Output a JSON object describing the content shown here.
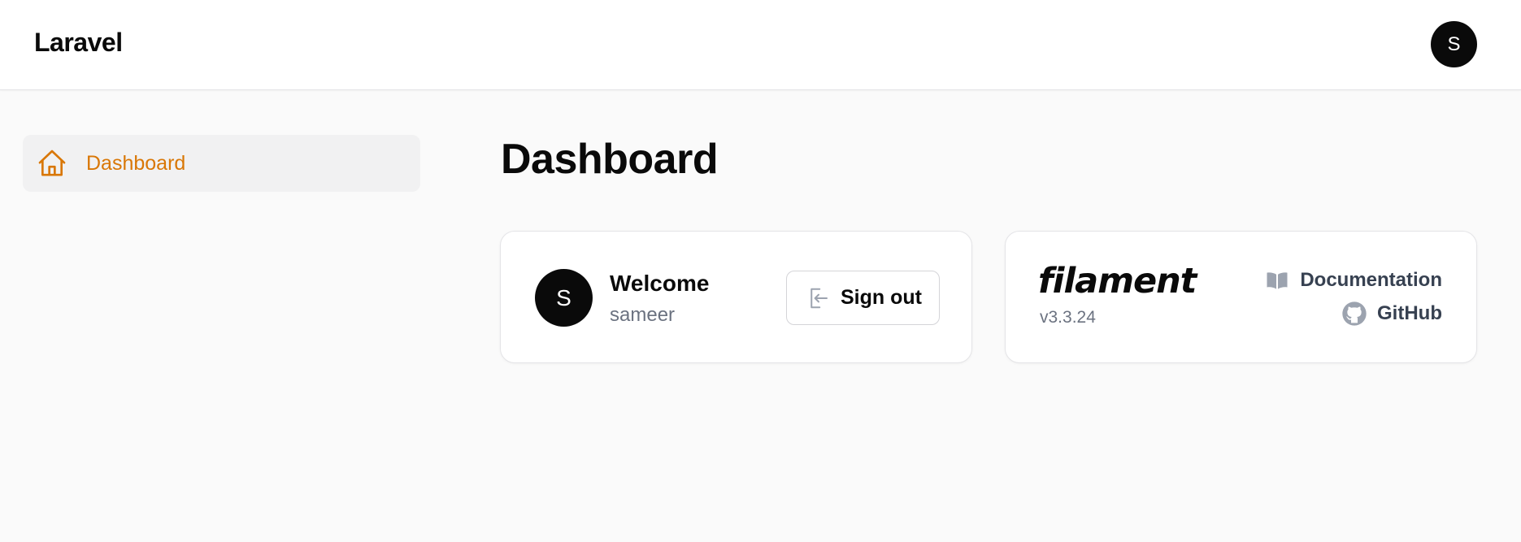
{
  "topbar": {
    "brand": "Laravel",
    "avatar_initial": "S"
  },
  "sidebar": {
    "items": [
      {
        "label": "Dashboard",
        "icon": "home-icon",
        "active": true
      }
    ]
  },
  "main": {
    "title": "Dashboard",
    "welcome_card": {
      "avatar_initial": "S",
      "heading": "Welcome",
      "username": "sameer",
      "signout_label": "Sign out",
      "signout_icon": "sign-out-icon"
    },
    "filament_card": {
      "logo_text": "filament",
      "version": "v3.3.24",
      "links": [
        {
          "label": "Documentation",
          "icon": "book-icon"
        },
        {
          "label": "GitHub",
          "icon": "github-icon"
        }
      ]
    }
  },
  "colors": {
    "accent": "#d97706",
    "avatar_bg": "#0a0a0a",
    "muted_text": "#6b7280"
  }
}
